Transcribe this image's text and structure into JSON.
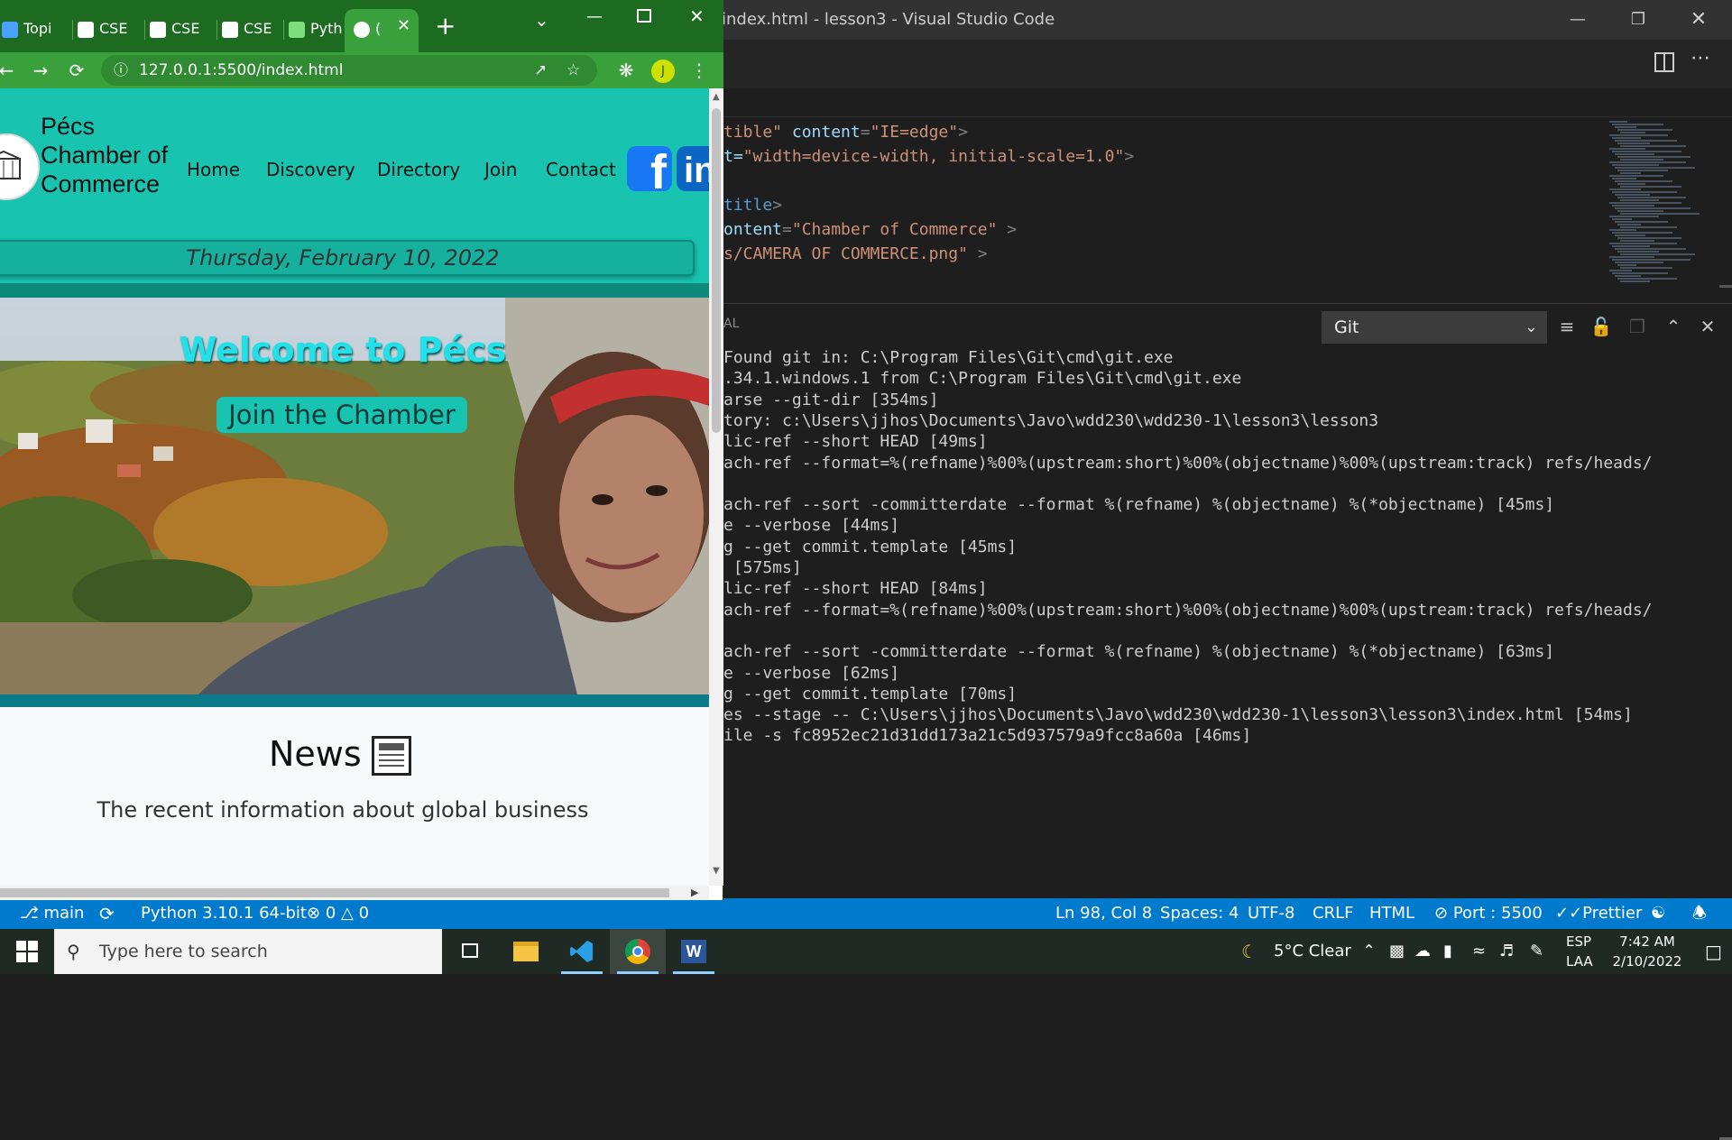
{
  "vscode": {
    "window_title": "index.html - lesson3 - Visual Studio Code",
    "editor_lines": [
      [
        {
          "t": "tible\"",
          "c": "str"
        },
        {
          "t": " content",
          "c": "attr"
        },
        {
          "t": "=",
          "c": "punc"
        },
        {
          "t": "\"IE=edge\"",
          "c": "str"
        },
        {
          "t": ">",
          "c": "punc"
        }
      ],
      [
        {
          "t": "t=",
          "c": "attr"
        },
        {
          "t": "\"width=device-width, initial-scale=1.0\"",
          "c": "str"
        },
        {
          "t": ">",
          "c": "punc"
        }
      ],
      [],
      [
        {
          "t": "title",
          "c": "tag"
        },
        {
          "t": ">",
          "c": "punc"
        }
      ],
      [
        {
          "t": "ontent",
          "c": "attr"
        },
        {
          "t": "=",
          "c": "punc"
        },
        {
          "t": "\"Chamber of Commerce\"",
          "c": "str"
        },
        {
          "t": " >",
          "c": "punc"
        }
      ],
      [
        {
          "t": "s/CAMERA OF COMMERCE.png\"",
          "c": "str"
        },
        {
          "t": " >",
          "c": "punc"
        }
      ]
    ],
    "panel": {
      "label": "AL",
      "output_channel": "Git",
      "output_lines": [
        "Found git in: C:\\Program Files\\Git\\cmd\\git.exe",
        ".34.1.windows.1 from C:\\Program Files\\Git\\cmd\\git.exe",
        "arse --git-dir [354ms]",
        "tory: c:\\Users\\jjhos\\Documents\\Javo\\wdd230\\wdd230-1\\lesson3\\lesson3",
        "lic-ref --short HEAD [49ms]",
        "ach-ref --format=%(refname)%00%(upstream:short)%00%(objectname)%00%(upstream:track) refs/heads/",
        "",
        "ach-ref --sort -committerdate --format %(refname) %(objectname) %(*objectname) [45ms]",
        "e --verbose [44ms]",
        "g --get commit.template [45ms]",
        " [575ms]",
        "lic-ref --short HEAD [84ms]",
        "ach-ref --format=%(refname)%00%(upstream:short)%00%(objectname)%00%(upstream:track) refs/heads/",
        "",
        "ach-ref --sort -committerdate --format %(refname) %(objectname) %(*objectname) [63ms]",
        "e --verbose [62ms]",
        "g --get commit.template [70ms]",
        "es --stage -- C:\\Users\\jjhos\\Documents\\Javo\\wdd230\\wdd230-1\\lesson3\\lesson3\\index.html [54ms]",
        "ile -s fc8952ec21d31dd173a21c5d937579a9fcc8a60a [46ms]"
      ]
    },
    "statusbar": {
      "branch": "main",
      "python": "Python 3.10.1 64-bit",
      "errors": "0",
      "warnings": "0",
      "position": "Ln 98, Col 8",
      "spaces": "Spaces: 4",
      "encoding": "UTF-8",
      "eol": "CRLF",
      "language": "HTML",
      "port": "Port : 5500",
      "prettier": "Prettier"
    }
  },
  "chrome": {
    "tabs": [
      {
        "label": "Topi",
        "icon": "bar-chart-icon"
      },
      {
        "label": "CSE",
        "icon": "robot-icon"
      },
      {
        "label": "CSE",
        "icon": "robot-icon"
      },
      {
        "label": "CSE",
        "icon": "robot-icon"
      },
      {
        "label": "Pyth",
        "icon": "w-logo-icon"
      },
      {
        "label": "(",
        "icon": "globe-icon",
        "active": true
      }
    ],
    "url": "127.0.0.1:5500/index.html",
    "profile_initial": "J",
    "page": {
      "site_name": "Pécs Chamber of Commerce",
      "nav": [
        "Home",
        "Discovery",
        "Directory",
        "Join",
        "Contact"
      ],
      "date": "Thursday, February 10, 2022",
      "hero_title": "Welcome to Pécs",
      "hero_button": "Join the Chamber",
      "news_title": "News",
      "news_subtitle": "The recent information about global business"
    }
  },
  "taskbar": {
    "search_placeholder": "Type here to search",
    "weather": "5°C  Clear",
    "language": "ESP",
    "layout": "LAA",
    "time": "7:42 AM",
    "date": "2/10/2022"
  }
}
